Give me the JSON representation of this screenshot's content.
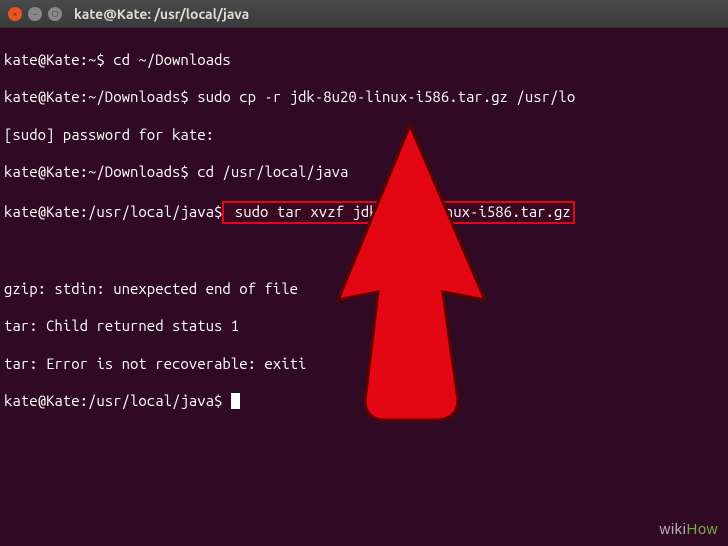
{
  "titlebar": {
    "title": "kate@Kate: /usr/local/java"
  },
  "terminal": {
    "lines": {
      "l1_prompt": "kate@Kate:~$",
      "l1_cmd": " cd ~/Downloads",
      "l2_prompt": "kate@Kate:~/Downloads$",
      "l2_cmd": " sudo cp -r jdk-8u20-linux-i586.tar.gz /usr/lo",
      "l3": "[sudo] password for kate:",
      "l4_prompt": "kate@Kate:~/Downloads$",
      "l4_cmd": " cd /usr/local/java",
      "l5_prompt": "kate@Kate:/usr/local/java$",
      "l5_cmd": " sudo tar xvzf jdk-8u20-linux-i586.tar.gz",
      "l6": "",
      "l7": "gzip: stdin: unexpected end of file",
      "l8": "tar: Child returned status 1",
      "l9": "tar: Error is not recoverable: exiti",
      "l10_prompt": "kate@Kate:/usr/local/java$",
      "l10_cmd": " "
    }
  },
  "watermark": {
    "wiki": "wiki",
    "how": "How"
  },
  "colors": {
    "terminal_bg": "#300a24",
    "text": "#ffffff",
    "highlight_border": "#e30613",
    "arrow_fill": "#e30613",
    "close_btn": "#e95420"
  }
}
